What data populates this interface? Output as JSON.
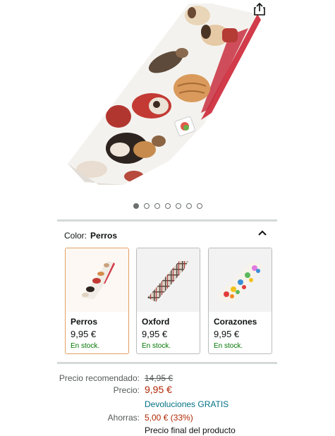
{
  "gallery": {
    "dots_total": 7,
    "dots_active": 1
  },
  "color_selector": {
    "label": "Color:",
    "selected": "Perros",
    "options": [
      {
        "name": "Perros",
        "price": "9,95 €",
        "stock": "En stock."
      },
      {
        "name": "Oxford",
        "price": "9,95 €",
        "stock": "En stock."
      },
      {
        "name": "Corazones",
        "price": "9,95 €",
        "stock": "En stock."
      }
    ]
  },
  "pricing": {
    "list_price_label": "Precio recomendado:",
    "list_price": "14,95 €",
    "price_label": "Precio:",
    "price": "9,95 €",
    "returns": "Devoluciones GRATIS",
    "savings_label": "Ahorras:",
    "savings": "5,00 € (33%)",
    "final_note": "Precio final del producto"
  },
  "colors": {
    "price_red": "#b12704",
    "stock_green": "#007600",
    "link_teal": "#007185",
    "selected_border": "#e3a063"
  }
}
